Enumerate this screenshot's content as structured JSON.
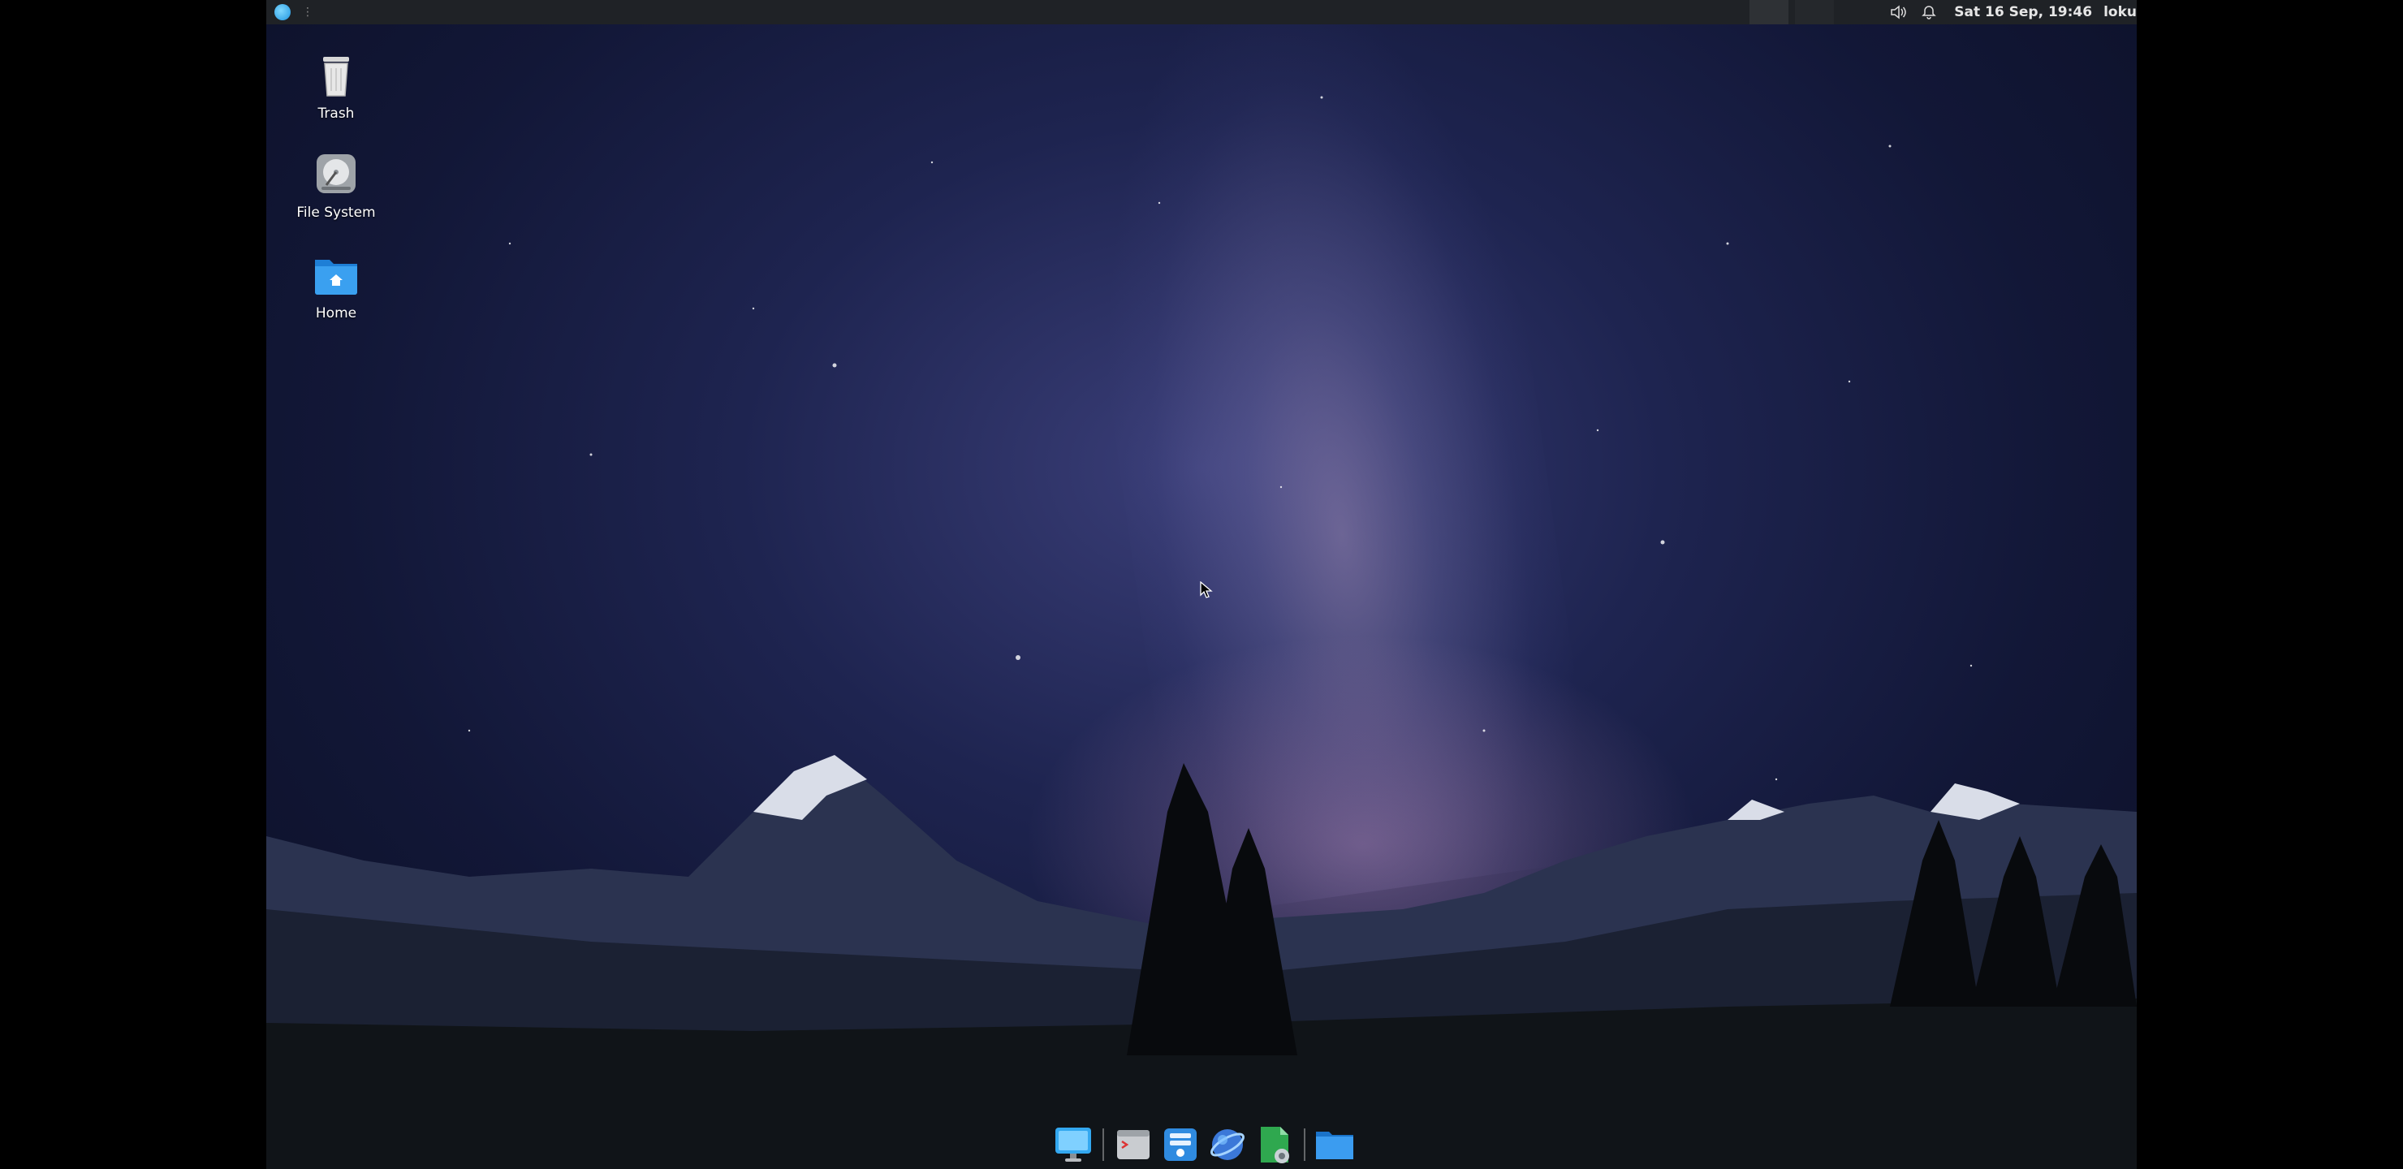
{
  "panel": {
    "clock": "Sat 16 Sep, 19:46",
    "user": "loku"
  },
  "desktop_icons": [
    {
      "label": "Trash",
      "icon": "trash-icon"
    },
    {
      "label": "File System",
      "icon": "drive-icon"
    },
    {
      "label": "Home",
      "icon": "home-folder-icon"
    }
  ],
  "dock": [
    {
      "icon": "show-desktop-icon"
    },
    {
      "icon": "terminal-icon"
    },
    {
      "icon": "file-manager-icon"
    },
    {
      "icon": "web-browser-icon"
    },
    {
      "icon": "spreadsheet-icon"
    },
    {
      "icon": "folder-icon"
    }
  ],
  "colors": {
    "panel_bg": "#1f2226",
    "accent": "#2196e0"
  }
}
